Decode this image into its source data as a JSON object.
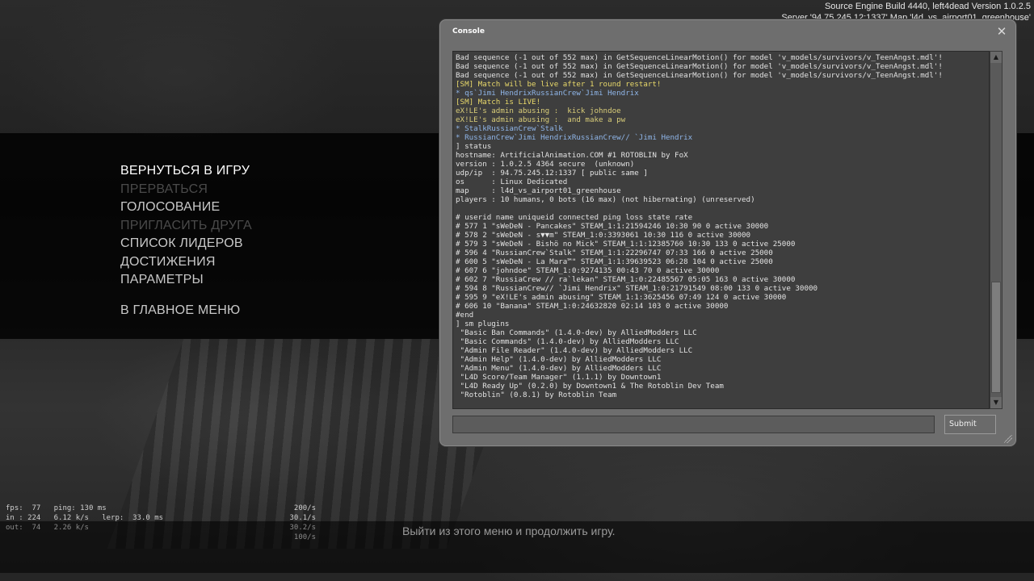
{
  "build_info": {
    "line1": "Source Engine Build 4440, left4dead Version 1.0.2.5",
    "line2": "Server '94.75.245.12:1337' Map 'l4d_vs_airport01_greenhouse'"
  },
  "menu": {
    "items": [
      {
        "label": "ВЕРНУТЬСЯ В ИГРУ",
        "state": "active"
      },
      {
        "label": "ПРЕРВАТЬСЯ",
        "state": "disabled"
      },
      {
        "label": "ГОЛОСОВАНИЕ",
        "state": "normal"
      },
      {
        "label": "ПРИГЛАСИТЬ ДРУГА",
        "state": "disabled"
      },
      {
        "label": "СПИСОК ЛИДЕРОВ",
        "state": "normal"
      },
      {
        "label": "ДОСТИЖЕНИЯ",
        "state": "normal"
      },
      {
        "label": "ПАРАМЕТРЫ",
        "state": "normal"
      },
      {
        "label": "В ГЛАВНОЕ МЕНЮ",
        "state": "normal"
      }
    ]
  },
  "hint": "Выйти из этого меню и продолжить игру.",
  "netgraph": [
    {
      "left": "fps:  77   ping: 130 ms",
      "right": "200/s",
      "left_color": "#d0d0d0",
      "right_color": "#d0d0d0"
    },
    {
      "left": "in : 224   6.12 k/s   lerp:  33.0 ms",
      "right": "30.1/s",
      "left_color": "#d0d0d0",
      "right_color": "#d0d0d0"
    },
    {
      "left": "out:  74   2.26 k/s",
      "right": "30.2/s",
      "left_color": "#8a8a8a",
      "right_color": "#8a8a8a"
    },
    {
      "left": "",
      "right": "100/s",
      "left_color": "#8a8a8a",
      "right_color": "#8a8a8a"
    }
  ],
  "console": {
    "title": "Console",
    "close_glyph": "✕",
    "submit_label": "Submit",
    "input_value": "",
    "colors": {
      "default": "#e2e2e2",
      "sm": "#e8d86a",
      "chat": "#8fb5e8",
      "admin": "#d8cc78"
    },
    "lines": [
      {
        "text": "Bad sequence (-1 out of 552 max) in GetSequenceLinearMotion() for model 'v_models/survivors/v_TeenAngst.mdl'!",
        "type": "default"
      },
      {
        "text": "Bad sequence (-1 out of 552 max) in GetSequenceLinearMotion() for model 'v_models/survivors/v_TeenAngst.mdl'!",
        "type": "default"
      },
      {
        "text": "Bad sequence (-1 out of 552 max) in GetSequenceLinearMotion() for model 'v_models/survivors/v_TeenAngst.mdl'!",
        "type": "default"
      },
      {
        "text": "[SM] Match will be live after 1 round restart!",
        "type": "sm"
      },
      {
        "text": "* qs`Jimi HendrixRussianCrew`Jimi Hendrix",
        "type": "chat"
      },
      {
        "text": "[SM] Match is LIVE!",
        "type": "sm"
      },
      {
        "text": "eX!LE's admin abusing :  kick johndoe",
        "type": "admin"
      },
      {
        "text": "eX!LE's admin abusing :  and make a pw",
        "type": "admin"
      },
      {
        "text": "* StalkRussianCrew`Stalk",
        "type": "chat"
      },
      {
        "text": "* RussianCrew`Jimi HendrixRussianCrew// `Jimi Hendrix",
        "type": "chat"
      },
      {
        "text": "] status",
        "type": "default"
      },
      {
        "text": "hostname: ArtificialAnimation.COM #1 ROTOBLIN by FoX",
        "type": "default"
      },
      {
        "text": "version : 1.0.2.5 4364 secure  (unknown)",
        "type": "default"
      },
      {
        "text": "udp/ip  : 94.75.245.12:1337 [ public same ]",
        "type": "default"
      },
      {
        "text": "os      : Linux Dedicated",
        "type": "default"
      },
      {
        "text": "map     : l4d_vs_airport01_greenhouse",
        "type": "default"
      },
      {
        "text": "players : 10 humans, 0 bots (16 max) (not hibernating) (unreserved)",
        "type": "default"
      },
      {
        "text": "",
        "type": "default"
      },
      {
        "text": "# userid name uniqueid connected ping loss state rate",
        "type": "default"
      },
      {
        "text": "# 577 1 \"sWeDeN - Pancakes\" STEAM_1:1:21594246 10:30 90 0 active 30000",
        "type": "default"
      },
      {
        "text": "# 578 2 \"sWeDeN - s▼▼m\" STEAM_1:0:3393061 10:30 116 0 active 30000",
        "type": "default"
      },
      {
        "text": "# 579 3 \"sWeDeN - Bishö no Mick\" STEAM_1:1:12385760 10:30 133 0 active 25000",
        "type": "default"
      },
      {
        "text": "# 596 4 \"RussianCrew`Stalk\" STEAM_1:1:22296747 07:33 166 0 active 25000",
        "type": "default"
      },
      {
        "text": "# 600 5 \"sWeDeN - La Mara™\" STEAM_1:1:39639523 06:28 104 0 active 25000",
        "type": "default"
      },
      {
        "text": "# 607 6 \"johndoe\" STEAM_1:0:9274135 00:43 70 0 active 30000",
        "type": "default"
      },
      {
        "text": "# 602 7 \"RussiaCrew // ra`lekan\" STEAM_1:0:22485567 05:05 163 0 active 30000",
        "type": "default"
      },
      {
        "text": "# 594 8 \"RussianCrew// `Jimi Hendrix\" STEAM_1:0:21791549 08:00 133 0 active 30000",
        "type": "default"
      },
      {
        "text": "# 595 9 \"eX!LE's admin abusing\" STEAM_1:1:3625456 07:49 124 0 active 30000",
        "type": "default"
      },
      {
        "text": "# 606 10 \"Banana\" STEAM_1:0:24632820 02:14 103 0 active 30000",
        "type": "default"
      },
      {
        "text": "#end",
        "type": "default"
      },
      {
        "text": "] sm plugins",
        "type": "default"
      },
      {
        "text": " \"Basic Ban Commands\" (1.4.0-dev) by AlliedModders LLC",
        "type": "default"
      },
      {
        "text": " \"Basic Commands\" (1.4.0-dev) by AlliedModders LLC",
        "type": "default"
      },
      {
        "text": " \"Admin File Reader\" (1.4.0-dev) by AlliedModders LLC",
        "type": "default"
      },
      {
        "text": " \"Admin Help\" (1.4.0-dev) by AlliedModders LLC",
        "type": "default"
      },
      {
        "text": " \"Admin Menu\" (1.4.0-dev) by AlliedModders LLC",
        "type": "default"
      },
      {
        "text": " \"L4D Score/Team Manager\" (1.1.1) by Downtown1",
        "type": "default"
      },
      {
        "text": " \"L4D Ready Up\" (0.2.0) by Downtown1 & The Rotoblin Dev Team",
        "type": "default"
      },
      {
        "text": " \"Rotoblin\" (0.8.1) by Rotoblin Team",
        "type": "default"
      }
    ]
  }
}
